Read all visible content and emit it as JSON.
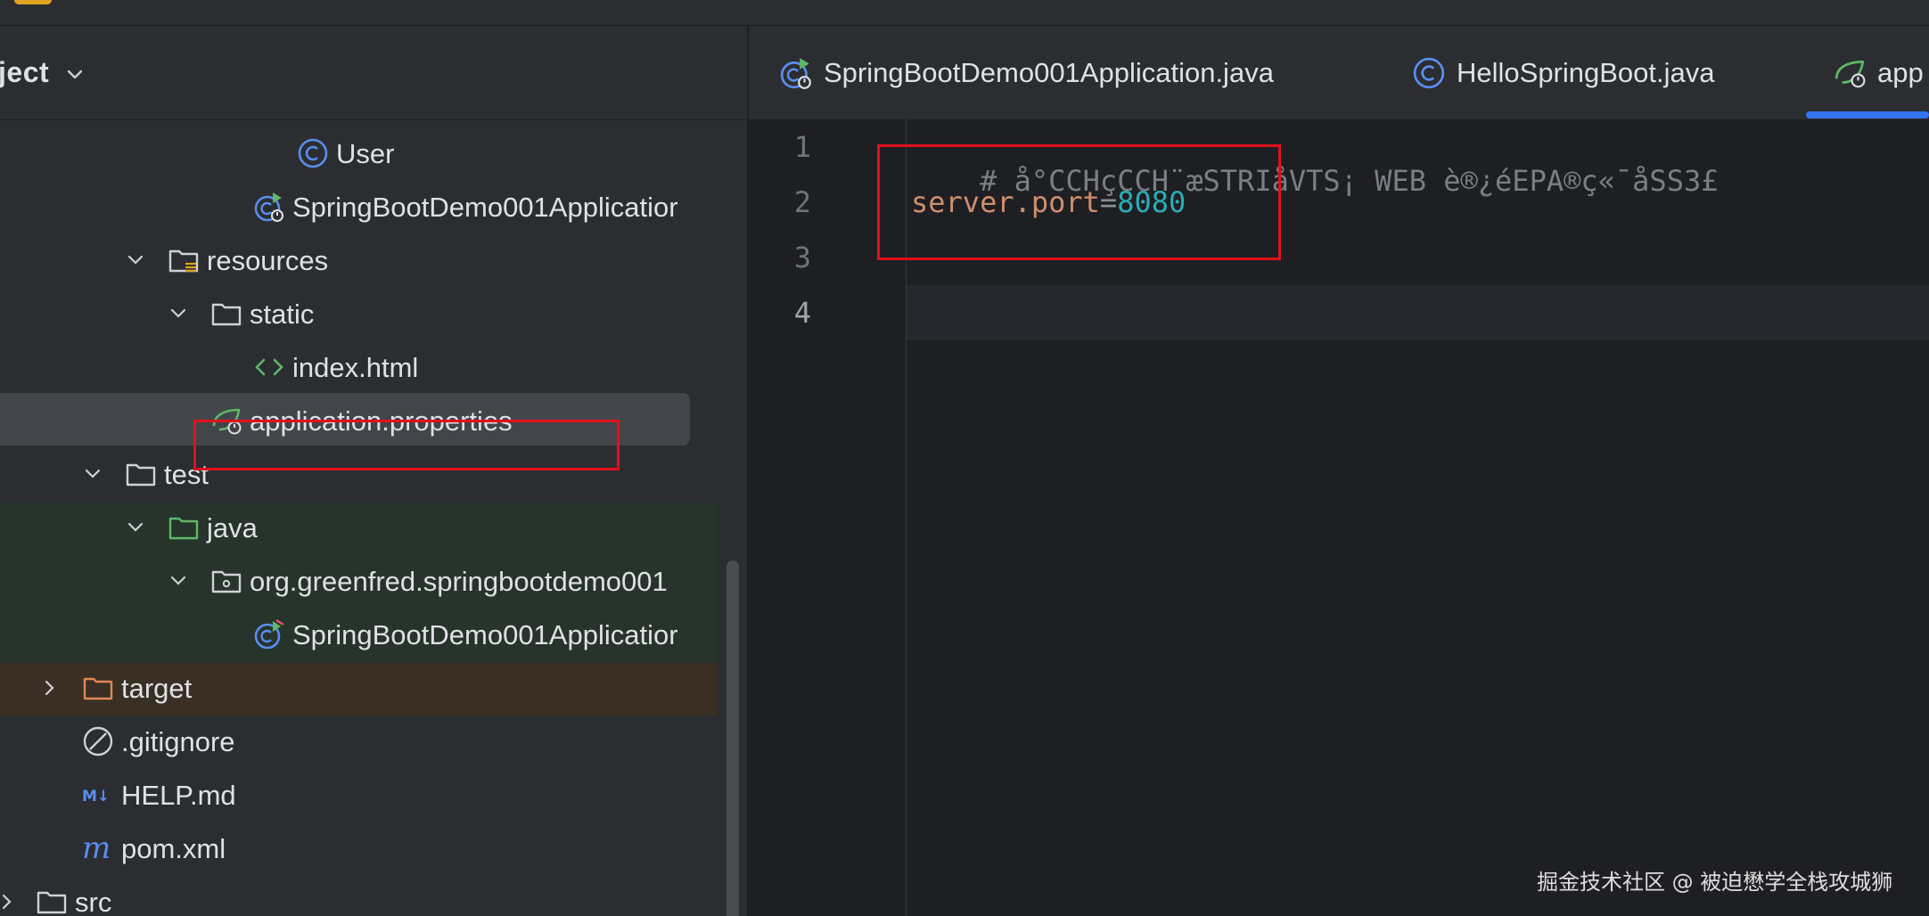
{
  "project_panel": {
    "title": "ject",
    "tree": [
      {
        "label": "User"
      },
      {
        "label": "SpringBootDemo001Applicatior"
      },
      {
        "label": "resources"
      },
      {
        "label": "static"
      },
      {
        "label": "index.html"
      },
      {
        "label": "application.properties"
      },
      {
        "label": "test"
      },
      {
        "label": "java"
      },
      {
        "label": "org.greenfred.springbootdemo001"
      },
      {
        "label": "SpringBootDemo001Applicatior"
      },
      {
        "label": "target"
      },
      {
        "label": ".gitignore"
      },
      {
        "label": "HELP.md"
      },
      {
        "label": "pom.xml"
      },
      {
        "label": "src"
      }
    ]
  },
  "editor": {
    "tabs": [
      {
        "label": "SpringBootDemo001Application.java"
      },
      {
        "label": "HelloSpringBoot.java"
      },
      {
        "label": "app"
      }
    ],
    "line_numbers": [
      "1",
      "2",
      "3",
      "4"
    ],
    "code": {
      "line1_comment": "# å°CCHçCCH¨æSTRIåVTS¡ WEB è®¿éEPA®ç«¯åSS3£",
      "line2_key": "server.port",
      "line2_eq": "=",
      "line2_value": "8080"
    }
  },
  "watermark": "掘金技术社区 @ 被迫懋学全栈攻城狮",
  "colors": {
    "highlight_box": "#e0111d",
    "accent": "#3574f0",
    "property_key": "#cf8e6d",
    "property_value": "#2aacb8"
  },
  "icons": {
    "class": "class-c-icon",
    "spring_app": "spring-boot-app-icon",
    "resources_folder": "resources-folder-icon",
    "folder": "folder-icon",
    "html": "html-file-icon",
    "properties": "spring-properties-icon",
    "package": "package-icon",
    "gitignore": "ignore-file-icon",
    "markdown": "markdown-icon",
    "maven": "maven-icon"
  }
}
